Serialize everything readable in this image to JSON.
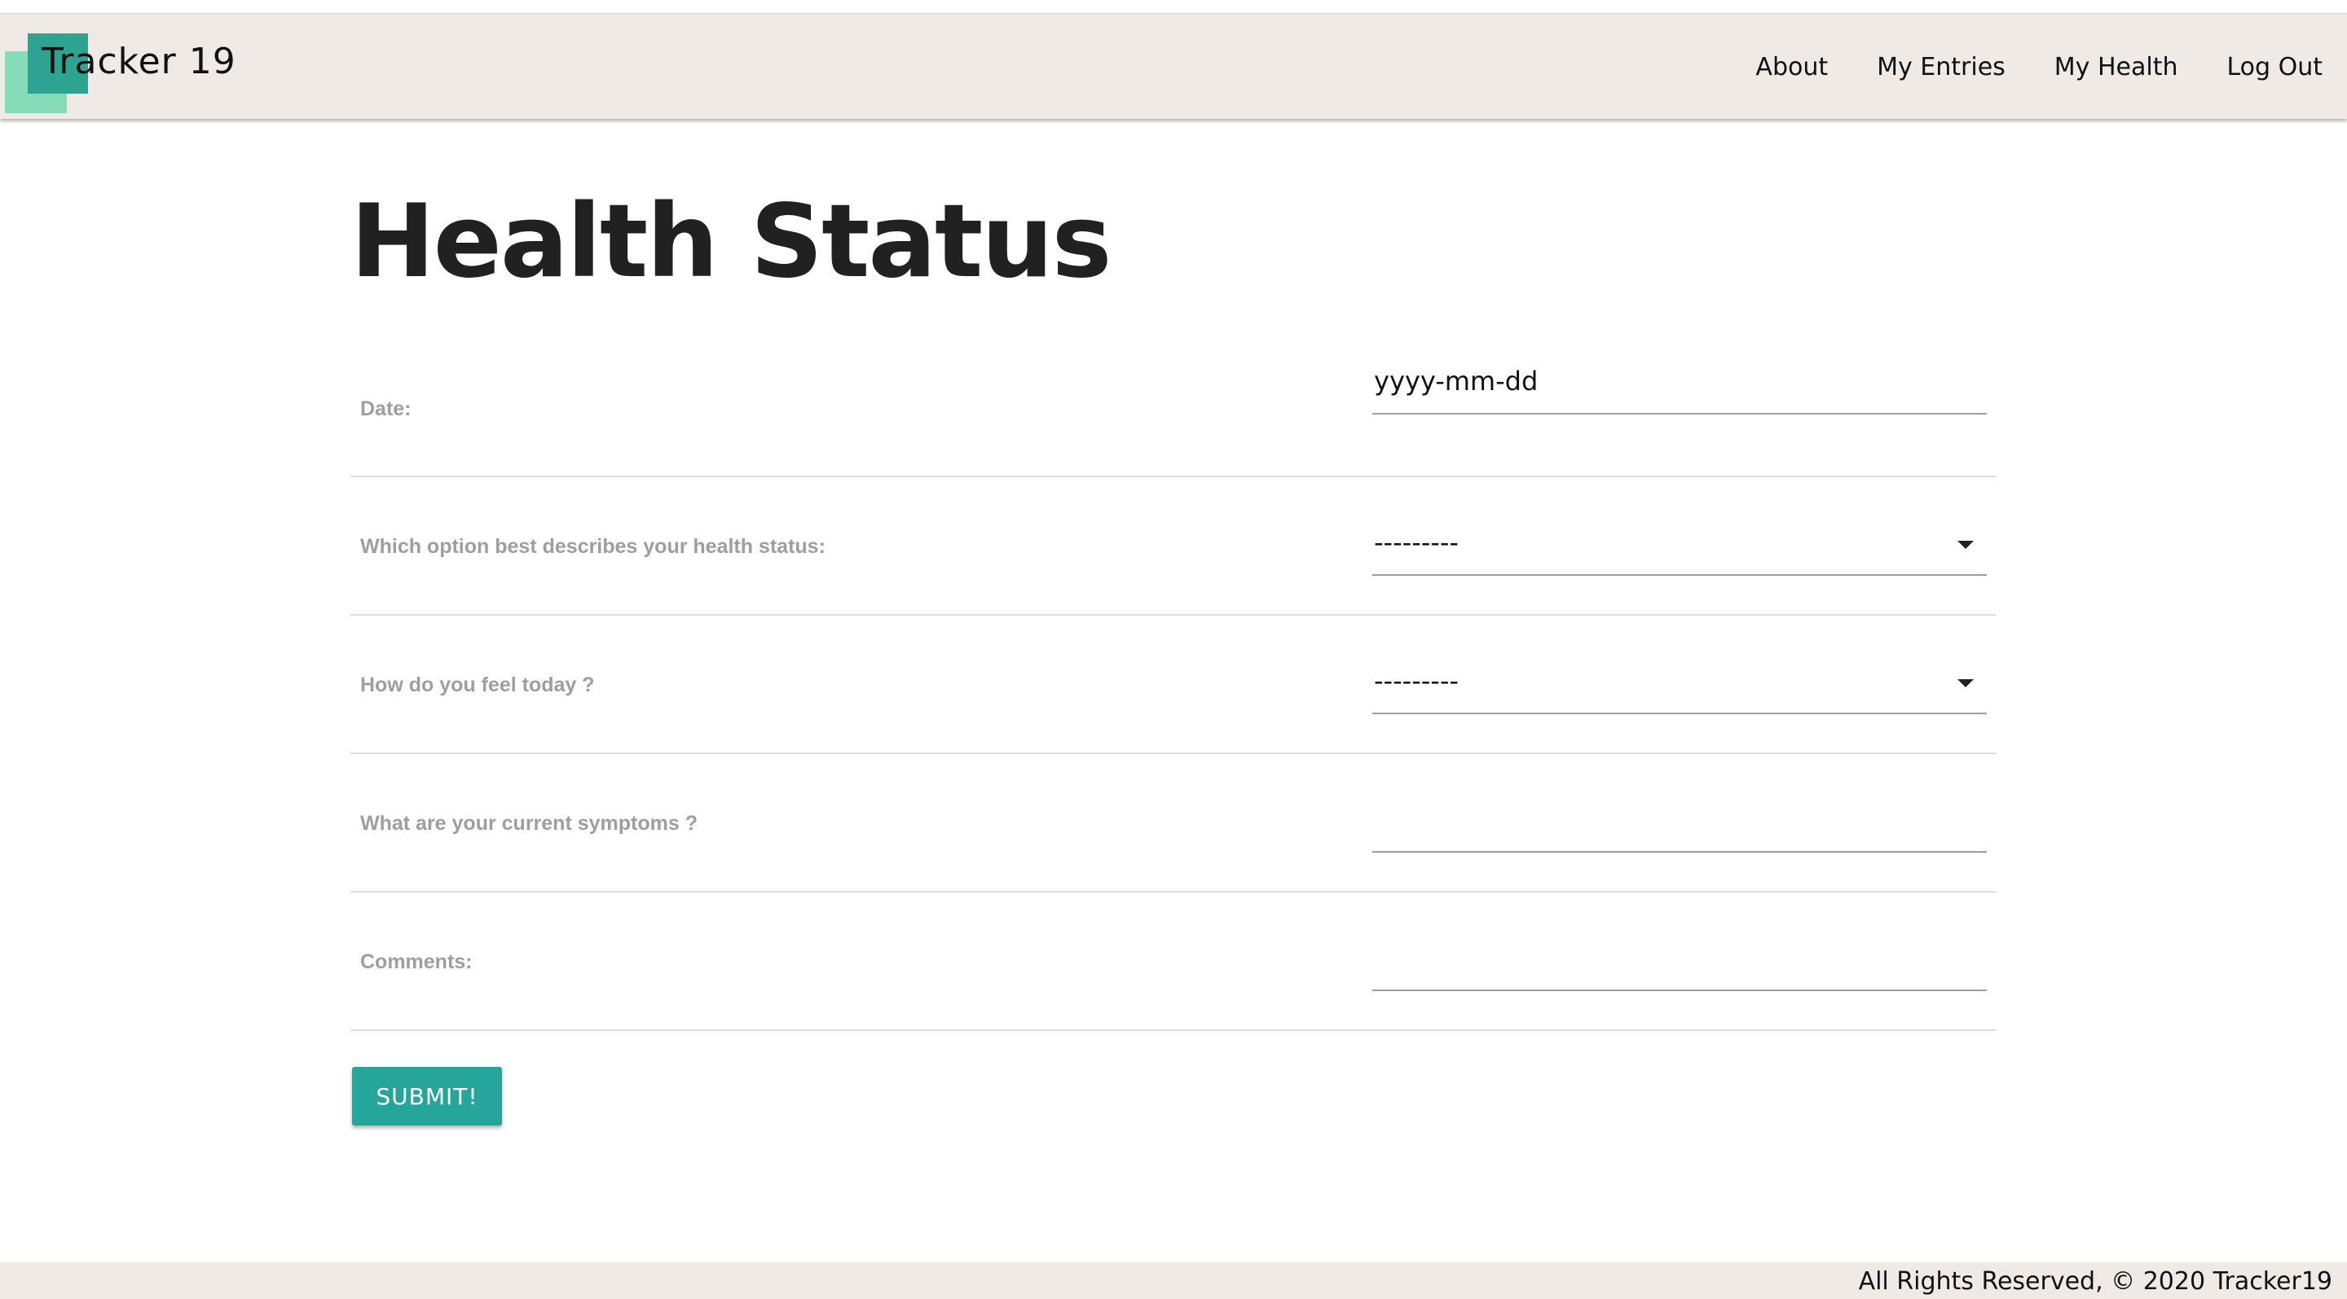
{
  "header": {
    "logo_text": "Tracker 19",
    "nav": [
      "About",
      "My Entries",
      "My Health",
      "Log Out"
    ]
  },
  "main": {
    "title": "Health Status",
    "form": {
      "date_label": "Date:",
      "date_placeholder": "yyyy-mm-dd",
      "status_label": "Which option best describes your health status:",
      "status_value": "---------",
      "feel_label": "How do you feel today ?",
      "feel_value": "---------",
      "symptoms_label": "What are your current symptoms ?",
      "symptoms_value": "",
      "comments_label": "Comments:",
      "comments_value": "",
      "submit_label": "SUBMIT!"
    }
  },
  "footer": {
    "text": "All Rights Reserved, © 2020 Tracker19"
  },
  "colors": {
    "header_bg": "#efeae6",
    "accent": "#26a69a",
    "logo_light": "#86dcb8",
    "logo_dark": "#2ea391",
    "label": "#9e9e9e"
  }
}
